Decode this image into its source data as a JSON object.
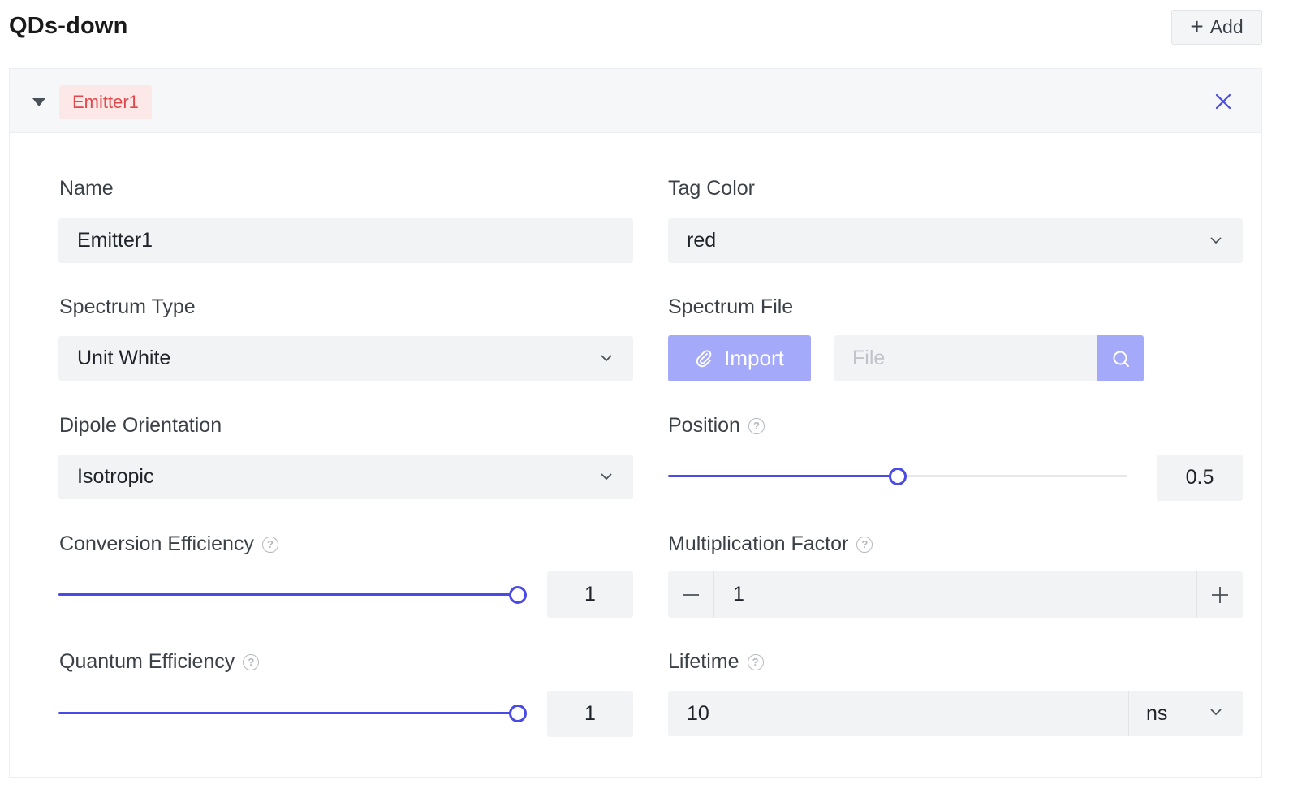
{
  "header": {
    "title": "QDs-down",
    "add_label": "Add"
  },
  "emitter": {
    "tag_label": "Emitter1",
    "tag_color": "#e0484b",
    "accent_color": "#4a4ae6",
    "fields": {
      "name": {
        "label": "Name",
        "value": "Emitter1"
      },
      "tag_color": {
        "label": "Tag Color",
        "value": "red"
      },
      "spectrum_type": {
        "label": "Spectrum Type",
        "value": "Unit White"
      },
      "spectrum_file": {
        "label": "Spectrum File",
        "import_label": "Import",
        "file_placeholder": "File"
      },
      "dipole_orientation": {
        "label": "Dipole Orientation",
        "value": "Isotropic"
      },
      "position": {
        "label": "Position",
        "value": "0.5",
        "fraction": 0.5
      },
      "conversion_efficiency": {
        "label": "Conversion Efficiency",
        "value": "1",
        "fraction": 1.0
      },
      "multiplication_factor": {
        "label": "Multiplication Factor",
        "value": "1"
      },
      "quantum_efficiency": {
        "label": "Quantum Efficiency",
        "value": "1",
        "fraction": 1.0
      },
      "lifetime": {
        "label": "Lifetime",
        "value": "10",
        "unit": "ns"
      }
    }
  },
  "icons": {
    "add": "plus-icon",
    "collapse": "caret-down-icon",
    "close": "close-icon",
    "dropdown": "chevron-down-icon",
    "attach": "paperclip-icon",
    "search": "search-icon",
    "help": "question-circle-icon",
    "decrement": "minus-icon",
    "increment": "plus-icon"
  }
}
